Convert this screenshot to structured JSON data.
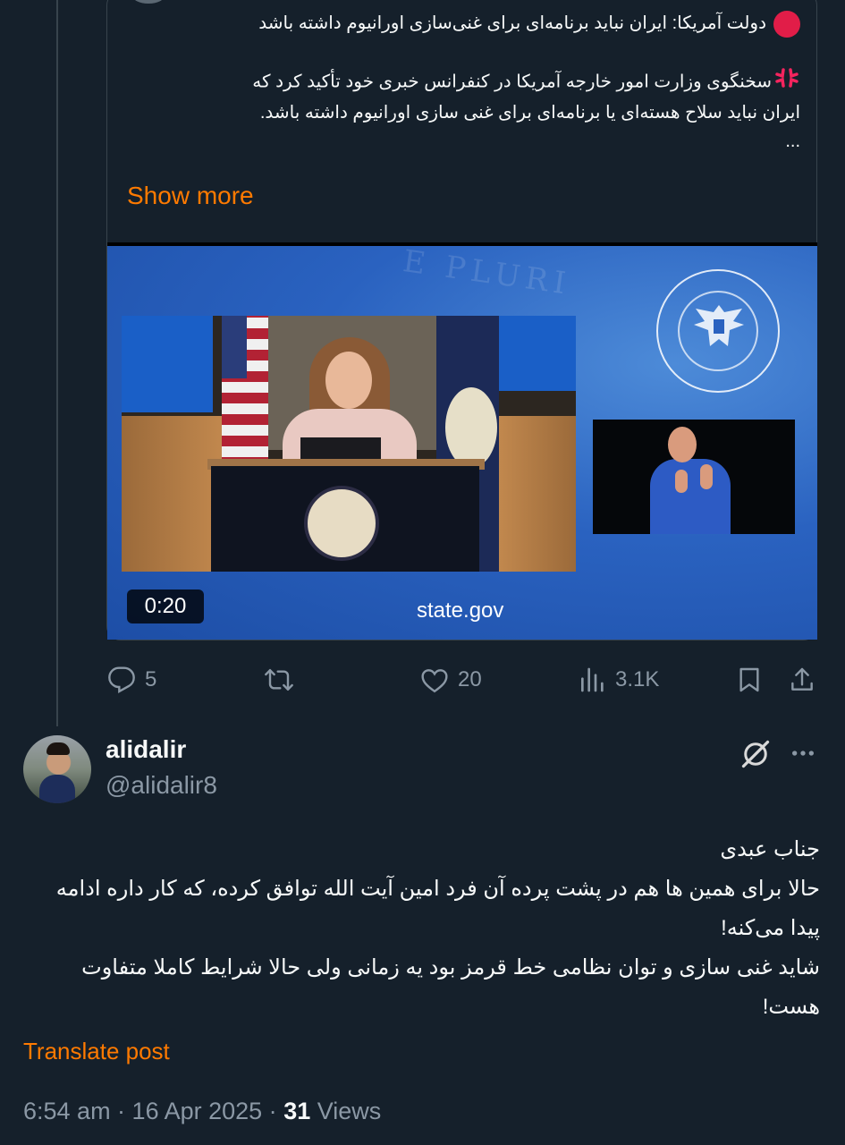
{
  "quote": {
    "headline": "دولت آمریکا: ایران نباید برنامه‌ای برای غنی‌سازی اورانیوم داشته باشد",
    "line1": "سخنگوی وزارت امور خارجه آمریکا در کنفرانس خبری خود تأکید کرد که",
    "line2": "ایران نباید سلاح هسته‌ای یا برنامه‌ای برای غنی سازی اورانیوم داشته باشد.",
    "ellipsis": "...",
    "show_more": "Show more",
    "video": {
      "duration": "0:20",
      "caption": "state.gov"
    }
  },
  "quote_actions": {
    "replies": "5",
    "reposts": "",
    "likes": "20",
    "views": "3.1K"
  },
  "reply": {
    "display_name": "alidalir",
    "handle": "@alidalir8",
    "body": [
      "جناب عبدی",
      "حالا برای همین ها هم در پشت پرده آن فرد امین آیت الله توافق کرده، که کار داره ادامه پیدا می‌کنه!",
      "شاید غنی سازی و توان نظامی خط قرمز بود یه زمانی ولی حالا شرایط کاملا متفاوت هست!"
    ],
    "translate": "Translate post",
    "time": "6:54 am · 16 Apr 2025 · ",
    "views_count": "31",
    "views_label": " Views"
  },
  "colors": {
    "background": "#15202b",
    "accent": "#ff7a00",
    "muted": "#8b98a5",
    "border": "#38444d"
  },
  "icons": [
    "red-circle-icon",
    "anger-symbol-icon",
    "reply-icon",
    "repost-icon",
    "like-icon",
    "views-icon",
    "bookmark-icon",
    "share-icon",
    "grok-icon",
    "more-icon"
  ]
}
